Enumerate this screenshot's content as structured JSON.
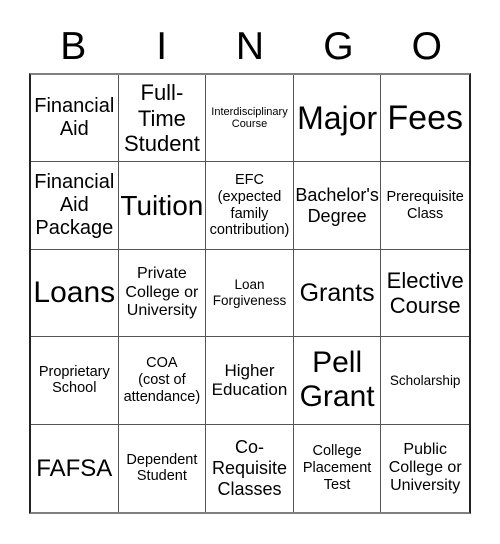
{
  "header": {
    "letters": [
      "B",
      "I",
      "N",
      "G",
      "O"
    ]
  },
  "grid": {
    "rows": [
      [
        "Financial\nAid",
        "Full-\nTime\nStudent",
        "Interdisciplinary\nCourse",
        "Major",
        "Fees"
      ],
      [
        "Financial\nAid\nPackage",
        "Tuition",
        "EFC\n(expected\nfamily\ncontribution)",
        "Bachelor's\nDegree",
        "Prerequisite\nClass"
      ],
      [
        "Loans",
        "Private\nCollege or\nUniversity",
        "Loan\nForgiveness",
        "Grants",
        "Elective\nCourse"
      ],
      [
        "Proprietary\nSchool",
        "COA\n(cost of\nattendance)",
        "Higher\nEducation",
        "Pell\nGrant",
        "Scholarship"
      ],
      [
        "FAFSA",
        "Dependent\nStudent",
        "Co-\nRequisite\nClasses",
        "College\nPlacement\nTest",
        "Public\nCollege or\nUniversity"
      ]
    ]
  }
}
